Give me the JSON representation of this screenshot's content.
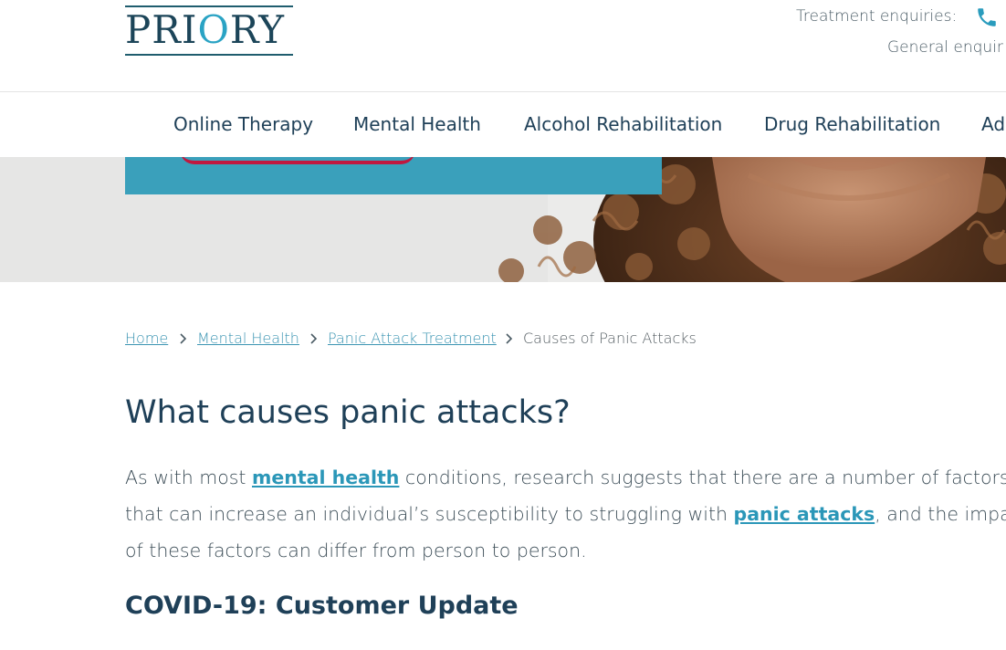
{
  "header": {
    "logo_text_before": "PRI",
    "logo_text_o": "O",
    "logo_text_after": "RY",
    "treatment_label": "Treatment enquiries:",
    "general_label": "General enquir",
    "phone_icon": "phone-icon"
  },
  "nav": {
    "items": [
      {
        "label": "Online Therapy"
      },
      {
        "label": "Mental Health"
      },
      {
        "label": "Alcohol Rehabilitation"
      },
      {
        "label": "Drug Rehabilitation"
      },
      {
        "label": "Ad"
      }
    ]
  },
  "breadcrumb": {
    "items": [
      {
        "label": "Home"
      },
      {
        "label": "Mental Health"
      },
      {
        "label": "Panic Attack Treatment"
      },
      {
        "label": "Causes of Panic Attacks"
      }
    ],
    "separator_icon": "chevron-right-icon"
  },
  "content": {
    "title": "What causes panic attacks?",
    "intro_part1": "As with most ",
    "intro_link1": "mental health",
    "intro_part2": " conditions, research suggests that there are a number of factors",
    "intro_part3": "that can increase an individual’s susceptibility to struggling with ",
    "intro_link2": "panic attacks",
    "intro_part4": ", and the impact",
    "intro_part5": "of these factors can differ from person to person.",
    "covid_title": "COVID-19: Customer Update"
  },
  "colors": {
    "brand_dark": "#1f4058",
    "accent_teal": "#3aa0bb",
    "link": "#2b97b8",
    "cta_red": "#c0183f"
  }
}
